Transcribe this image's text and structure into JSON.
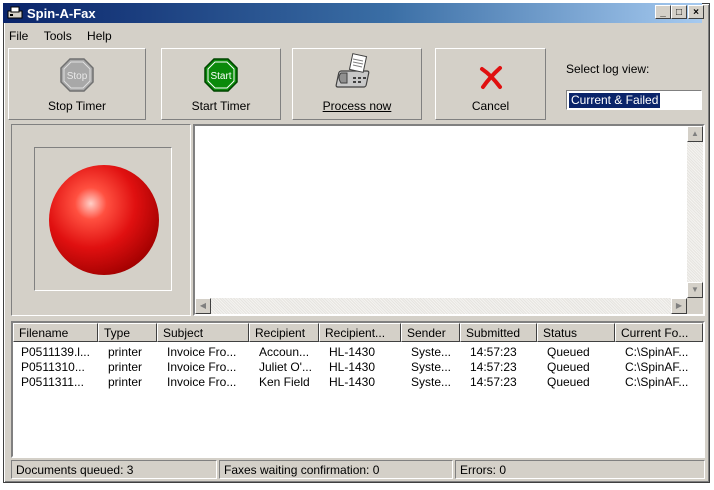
{
  "window": {
    "title": "Spin-A-Fax"
  },
  "title_buttons": {
    "minimize": "_",
    "maximize": "□",
    "close": "×"
  },
  "menu": [
    "File",
    "Tools",
    "Help"
  ],
  "toolbar": {
    "stop_icon_text": "Stop",
    "stop_label": "Stop Timer",
    "start_icon_text": "Start",
    "start_label": "Start Timer",
    "process_label": "Process now",
    "cancel_label": "Cancel"
  },
  "log_view": {
    "label": "Select log view:",
    "selected": "Current & Failed"
  },
  "colors": {
    "title_start": "#0a246a",
    "title_end": "#a6caf0",
    "status_light": "#e01010",
    "stop_gray": "#a0a0a0",
    "start_green": "#0a8a0a"
  },
  "queue": {
    "columns": [
      "Filename",
      "Type",
      "Subject",
      "Recipient",
      "Recipient...",
      "Sender",
      "Submitted",
      "Status",
      "Current Fo..."
    ],
    "rows": [
      [
        "P0511139.l...",
        "printer",
        "Invoice Fro...",
        "Accoun...",
        "HL-1430",
        "Syste...",
        "14:57:23",
        "Queued",
        "C:\\SpinAF..."
      ],
      [
        "P0511310...",
        "printer",
        "Invoice Fro...",
        "Juliet O'...",
        "HL-1430",
        "Syste...",
        "14:57:23",
        "Queued",
        "C:\\SpinAF..."
      ],
      [
        "P0511311...",
        "printer",
        "Invoice Fro...",
        "Ken Field",
        "HL-1430",
        "Syste...",
        "14:57:23",
        "Queued",
        "C:\\SpinAF..."
      ]
    ]
  },
  "status": {
    "queued": "Documents queued: 3",
    "waiting": "Faxes waiting confirmation: 0",
    "errors": "Errors: 0"
  }
}
